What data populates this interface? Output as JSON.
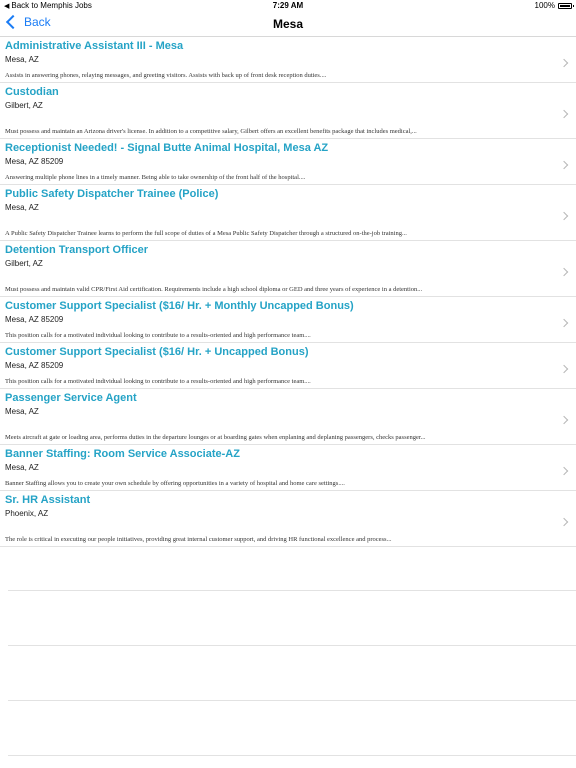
{
  "status_bar": {
    "back_app": "Back to Memphis Jobs",
    "time": "7:29 AM",
    "battery": "100%"
  },
  "nav": {
    "back_label": "Back",
    "title": "Mesa"
  },
  "jobs": [
    {
      "title": "Administrative Assistant III - Mesa",
      "location": "Mesa, AZ",
      "description": "Assists in answering phones, relaying messages, and greeting visitors. Assists with back up of front desk reception duties...."
    },
    {
      "title": "Custodian",
      "location": "Gilbert, AZ",
      "description": "Must possess and maintain an Arizona driver's license. In addition to a competitive salary, Gilbert offers an excellent benefits package that includes medical,..."
    },
    {
      "title": "Receptionist Needed! - Signal Butte Animal Hospital, Mesa AZ",
      "location": "Mesa, AZ 85209",
      "description": "Answering multiple phone lines in a timely manner. Being able to take ownership of the front half of the hospital...."
    },
    {
      "title": "Public Safety Dispatcher Trainee (Police)",
      "location": "Mesa, AZ",
      "description": "A Public Safety Dispatcher Trainee learns to perform the full scope of duties of a Mesa Public Safety Dispatcher through a structured on-the-job training..."
    },
    {
      "title": "Detention Transport Officer",
      "location": "Gilbert, AZ",
      "description": "Must possess and maintain valid CPR/First Aid certification. Requirements include a high school diploma or GED and three years of experience in a detention..."
    },
    {
      "title": "Customer Support Specialist ($16/ Hr. + Monthly Uncapped Bonus)",
      "location": "Mesa, AZ 85209",
      "description": "This position calls for a motivated individual looking to contribute to a results-oriented and high performance team...."
    },
    {
      "title": "Customer Support Specialist ($16/ Hr. + Uncapped Bonus)",
      "location": "Mesa, AZ 85209",
      "description": "This position calls for a motivated individual looking to contribute to a results-oriented and high performance team...."
    },
    {
      "title": "Passenger Service Agent",
      "location": "Mesa, AZ",
      "description": "Meets aircraft at gate or loading area, performs duties in the departure lounges or at boarding gates when enplaning and deplaning passengers, checks passenger..."
    },
    {
      "title": "Banner Staffing: Room Service Associate-AZ",
      "location": "Mesa, AZ",
      "description": "Banner Staffing allows you to create your own schedule by offering opportunities in a variety of hospital and home care settings...."
    },
    {
      "title": "Sr. HR Assistant",
      "location": "Phoenix, AZ",
      "description": "The role is critical in executing our people initiatives, providing great internal customer support, and driving HR functional excellence and process..."
    }
  ],
  "accent_color": "#25a3c6",
  "link_color": "#1a7cf5"
}
